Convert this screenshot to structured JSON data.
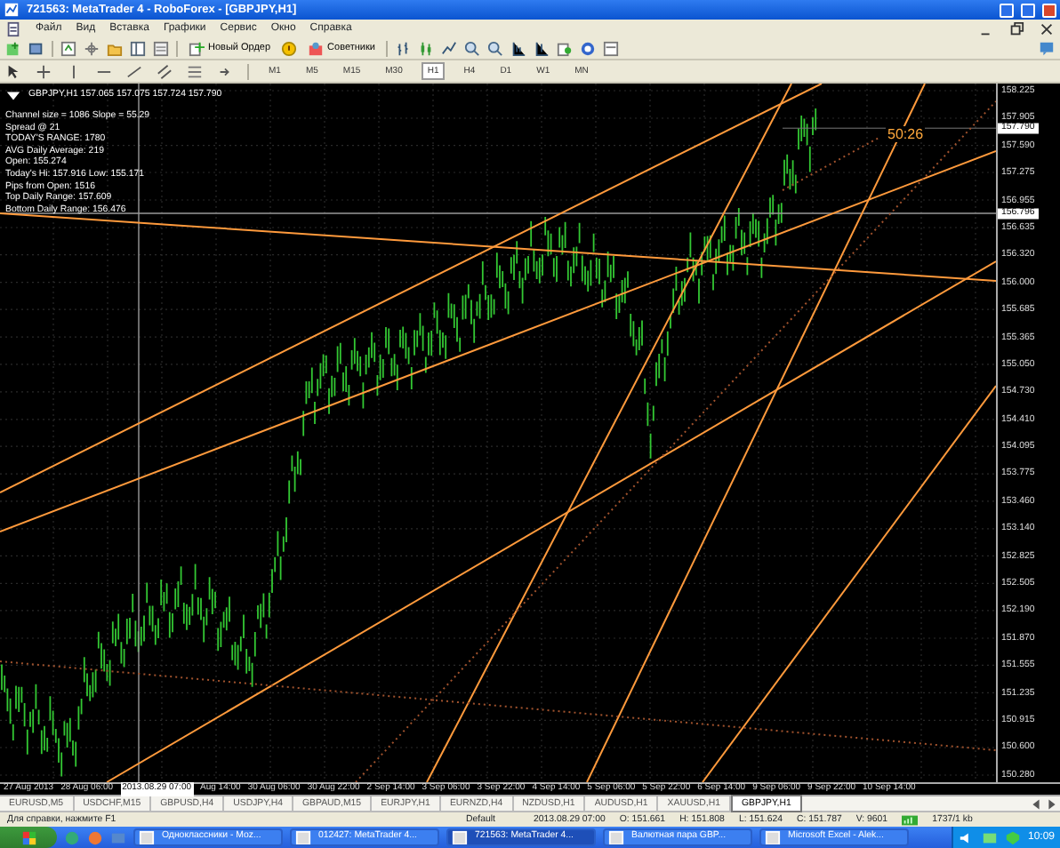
{
  "window": {
    "title": "721563: MetaTrader 4 - RoboForex - [GBPJPY,H1]"
  },
  "menu": [
    "Файл",
    "Вид",
    "Вставка",
    "Графики",
    "Сервис",
    "Окно",
    "Справка"
  ],
  "toolbar": {
    "new_order": "Новый Ордер",
    "experts": "Советники"
  },
  "timeframes": [
    {
      "label": "M1",
      "selected": false
    },
    {
      "label": "M5",
      "selected": false
    },
    {
      "label": "M15",
      "selected": false
    },
    {
      "label": "M30",
      "selected": false
    },
    {
      "label": "H1",
      "selected": true
    },
    {
      "label": "H4",
      "selected": false
    },
    {
      "label": "D1",
      "selected": false
    },
    {
      "label": "W1",
      "selected": false
    },
    {
      "label": "MN",
      "selected": false
    }
  ],
  "chart": {
    "header": "GBPJPY,H1  157.065 157.075 157.724 157.790",
    "info_lines": [
      "Channel size = 1086 Slope = 55.29",
      "Spread @ 21",
      "TODAY'S RANGE: 1780",
      "AVG Daily Average: 219",
      "Open: 155.274",
      "Today's Hi: 157.916  Low: 155.171",
      "Pips from Open: 1516",
      "Top Daily Range: 157.609",
      "Bottom Daily Range: 156.476"
    ],
    "timer": "50:26",
    "price_labels": [
      "158.225",
      "157.905",
      "157.590",
      "157.275",
      "156.955",
      "156.635",
      "156.320",
      "156.000",
      "155.685",
      "155.365",
      "155.050",
      "154.730",
      "154.410",
      "154.095",
      "153.775",
      "153.460",
      "153.140",
      "152.825",
      "152.505",
      "152.190",
      "151.870",
      "151.555",
      "151.235",
      "150.915",
      "150.600",
      "150.280"
    ],
    "price_markers": [
      "157.790",
      "156.796"
    ],
    "time_labels": [
      "27 Aug 2013",
      "28 Aug 06:00",
      "Aug 14:00",
      "30 Aug 06:00",
      "30 Aug 22:00",
      "2 Sep 14:00",
      "3 Sep 06:00",
      "3 Sep 22:00",
      "4 Sep 14:00",
      "5 Sep 06:00",
      "5 Sep 22:00",
      "6 Sep 14:00",
      "9 Sep 06:00",
      "9 Sep 22:00",
      "10 Sep 14:00"
    ],
    "crosshair_time": "2013.08.29 07:00"
  },
  "symbol_tabs": [
    {
      "label": "EURUSD,M5",
      "selected": false
    },
    {
      "label": "USDCHF,M15",
      "selected": false
    },
    {
      "label": "GBPUSD,H4",
      "selected": false
    },
    {
      "label": "USDJPY,H4",
      "selected": false
    },
    {
      "label": "GBPAUD,M15",
      "selected": false
    },
    {
      "label": "EURJPY,H1",
      "selected": false
    },
    {
      "label": "EURNZD,H4",
      "selected": false
    },
    {
      "label": "NZDUSD,H1",
      "selected": false
    },
    {
      "label": "AUDUSD,H1",
      "selected": false
    },
    {
      "label": "XAUUSD,H1",
      "selected": false
    },
    {
      "label": "GBPJPY,H1",
      "selected": true
    }
  ],
  "status_bar": {
    "help": "Для справки, нажмите F1",
    "profile": "Default",
    "time": "2013.08.29 07:00",
    "ohlcv": [
      "O: 151.661",
      "H: 151.808",
      "L: 151.624",
      "C: 151.787",
      "V: 9601"
    ],
    "traffic": "1737/1 kb"
  },
  "taskbar": {
    "tasks": [
      {
        "label": "Одноклассники - Moz...",
        "selected": false
      },
      {
        "label": "012427: MetaTrader 4...",
        "selected": false
      },
      {
        "label": "721563: MetaTrader 4...",
        "selected": true
      },
      {
        "label": "Валютная пара GBP...",
        "selected": false
      },
      {
        "label": "Microsoft Excel - Alek...",
        "selected": false
      }
    ],
    "clock": "10:09"
  }
}
